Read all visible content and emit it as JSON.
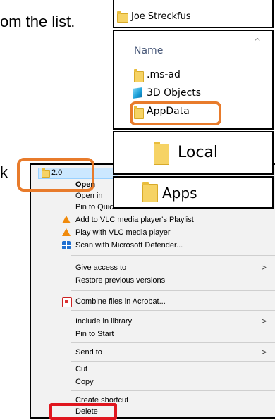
{
  "instruction": {
    "line1_fragment": "om the list.",
    "line2_fragment": "k"
  },
  "panel_user": {
    "folder_name": "Joe Streckfus"
  },
  "panel_explorer": {
    "column_header": "Name",
    "items": [
      ".ms-ad",
      "3D Objects",
      "AppData"
    ],
    "highlighted_item": "AppData"
  },
  "panel_local": {
    "folder_name": "Local"
  },
  "panel_apps": {
    "folder_name": "Apps"
  },
  "context_menu": {
    "selected_folder": "2.0",
    "items": {
      "open": "Open",
      "open_in": "Open in",
      "pin_quick": "Pin to Quick access",
      "vlc_playlist": "Add to VLC media player's Playlist",
      "vlc_play": "Play with VLC media player",
      "defender": "Scan with Microsoft Defender...",
      "give_access": "Give access to",
      "restore": "Restore previous versions",
      "acrobat": "Combine files in Acrobat...",
      "include_library": "Include in library",
      "pin_start": "Pin to Start",
      "send_to": "Send to",
      "cut": "Cut",
      "copy": "Copy",
      "create_shortcut": "Create shortcut",
      "delete": "Delete"
    },
    "highlight_colors": {
      "folder": "#e87b2b",
      "delete": "#e0161f"
    }
  }
}
